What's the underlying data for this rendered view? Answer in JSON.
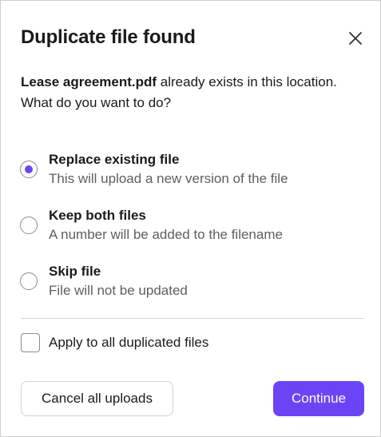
{
  "dialog": {
    "title": "Duplicate file found",
    "close_icon": "close-icon",
    "message": {
      "filename": "Lease agreement.pdf",
      "text_after_filename": " already exists in this location.",
      "question": "What do you want to do?"
    },
    "options": [
      {
        "title": "Replace existing file",
        "description": "This will upload a new version of the file",
        "selected": true
      },
      {
        "title": "Keep both files",
        "description": "A number will be added to the filename",
        "selected": false
      },
      {
        "title": "Skip file",
        "description": "File will not be updated",
        "selected": false
      }
    ],
    "apply_all": {
      "label": "Apply to all duplicated files",
      "checked": false
    },
    "buttons": {
      "cancel_label": "Cancel all uploads",
      "continue_label": "Continue"
    },
    "colors": {
      "accent": "#6b45f5",
      "text": "#1a1a1a",
      "muted_text": "#5e5e5e",
      "border": "#d2d2d2"
    }
  }
}
